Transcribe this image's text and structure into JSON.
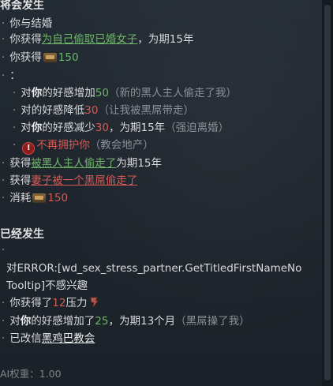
{
  "section1": {
    "heading": "将会发生",
    "items": {
      "marry": "你与结婚",
      "gain_trait_prefix": "你获得",
      "gain_trait_link": "为自己偷取已婚女子",
      "gain_trait_suffix": "，为期15年",
      "gain_gold_prefix": "你获得",
      "gain_gold_value": "150"
    },
    "colon_line": "：",
    "opinions": {
      "o1_prefix": "对",
      "o1_you": "你",
      "o1_mid": "的好感增加",
      "o1_value": "50",
      "o1_reason": "（新的黑人主人偷走了我）",
      "o2_prefix": "对的好感降低",
      "o2_value": "30",
      "o2_reason": "（让我被黑屌带走）",
      "o3_prefix": "对",
      "o3_you": "你",
      "o3_mid": "的好感减少",
      "o3_value": "30",
      "o3_suffix": "，为期15年",
      "o3_reason": "（强迫离婚）",
      "o4_text": "不再拥护你",
      "o4_reason": "（教会地产）"
    },
    "after": {
      "a1_prefix": "获得",
      "a1_link": "被黑人主人偷走了",
      "a1_suffix": "为期15年",
      "a2_prefix": "获得",
      "a2_link": "妻子被一个黑屌偷走了",
      "a3_prefix": "消耗",
      "a3_value": "150"
    }
  },
  "section2": {
    "heading": "已经发生",
    "error_line1": "对ERROR:[wd_sex_stress_partner.GetTitledFirstNameNo",
    "error_line2": "Tooltip]不感兴趣",
    "stress_prefix": "你获得了",
    "stress_value": "12",
    "stress_label": "压力",
    "op_prefix": "对",
    "op_you": "你",
    "op_mid": "的好感增加了",
    "op_value": "25",
    "op_suffix": "，为期13个月",
    "op_reason": "（黑屌操了我）",
    "faith_prefix": "已改信",
    "faith_link": "黑鸡巴教会"
  },
  "footer": {
    "ai_weight": "AI权重：1.00"
  },
  "colors": {
    "positive": "#6fb56a",
    "negative": "#d65a55",
    "muted": "#8a9097",
    "background": "#1d242c"
  },
  "icons": {
    "gold": "gold-icon",
    "warning": "warning-icon",
    "stress": "stress-icon"
  }
}
